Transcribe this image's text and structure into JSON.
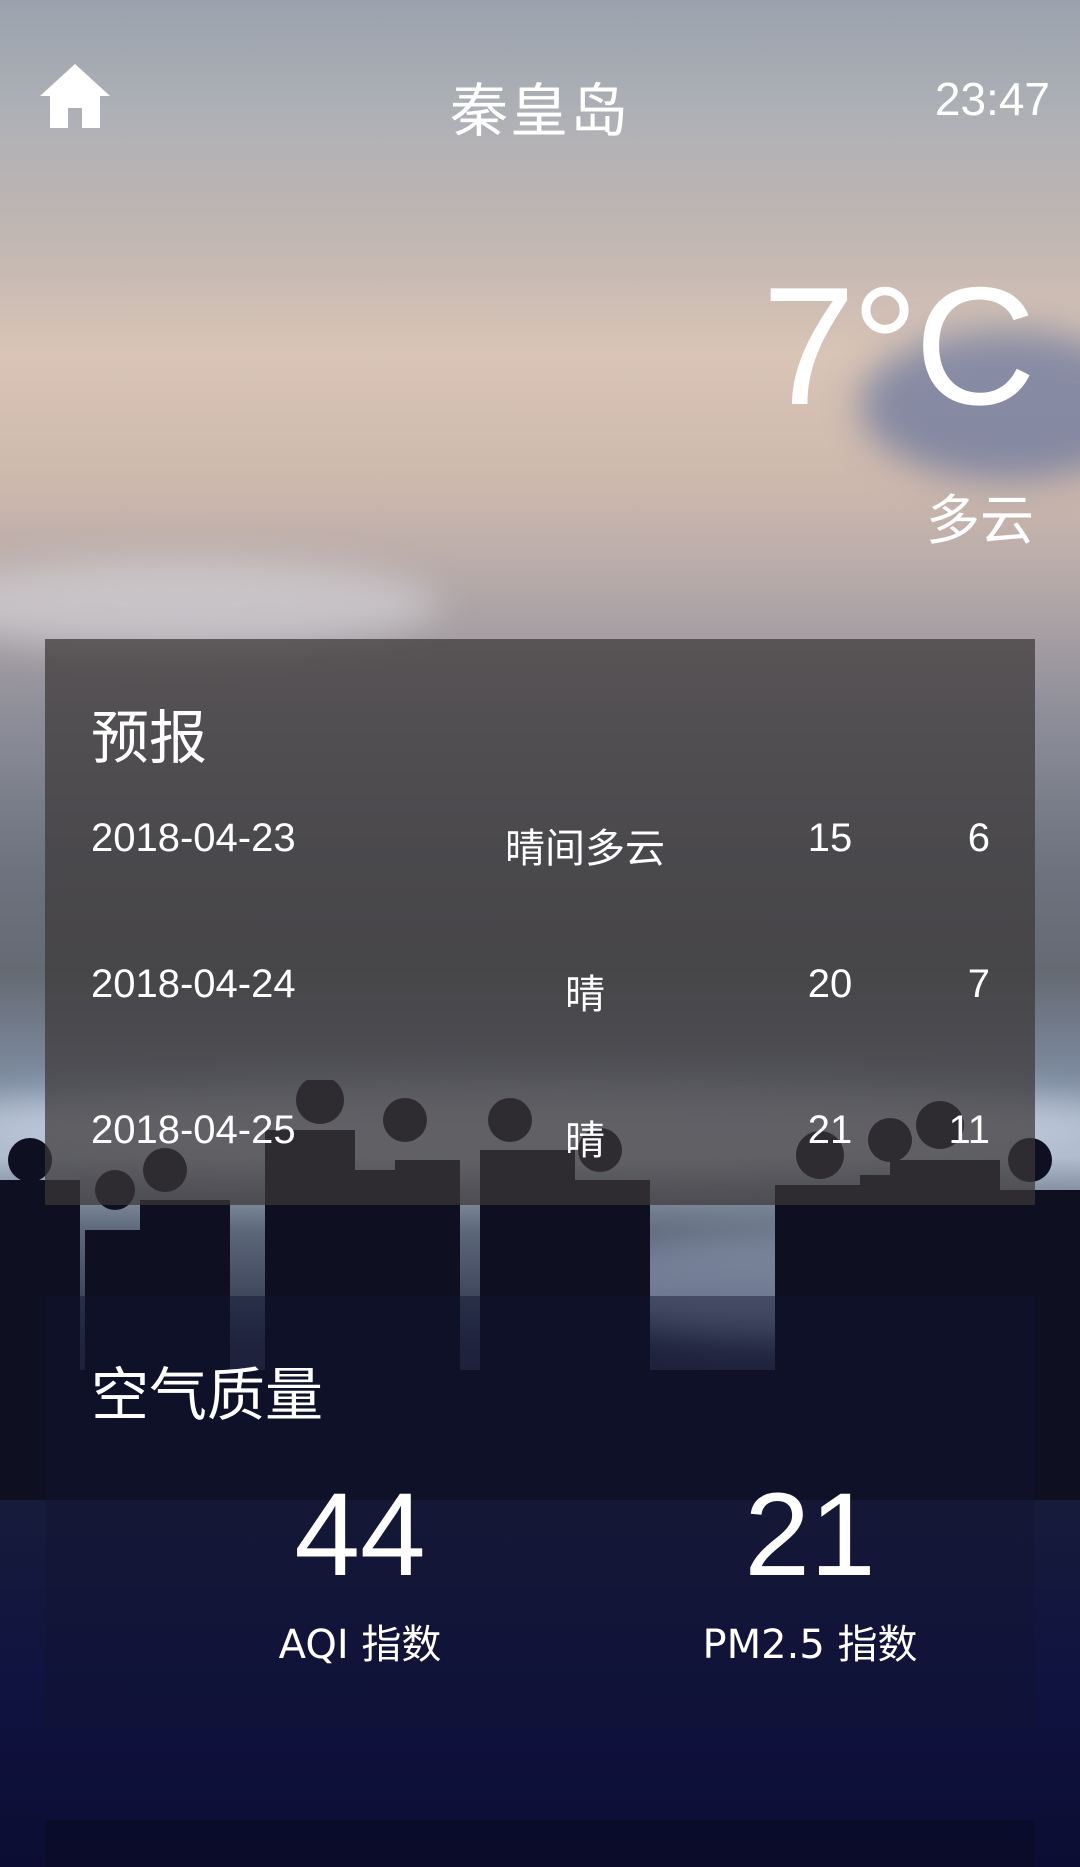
{
  "header": {
    "city": "秦皇岛",
    "time": "23:47"
  },
  "current": {
    "temperature": "7°C",
    "condition": "多云"
  },
  "forecast": {
    "title": "预报",
    "rows": [
      {
        "date": "2018-04-23",
        "condition": "晴间多云",
        "max": "15",
        "min": "6"
      },
      {
        "date": "2018-04-24",
        "condition": "晴",
        "max": "20",
        "min": "7"
      },
      {
        "date": "2018-04-25",
        "condition": "晴",
        "max": "21",
        "min": "11"
      }
    ]
  },
  "air_quality": {
    "title": "空气质量",
    "aqi_value": "44",
    "aqi_label": "AQI 指数",
    "pm25_value": "21",
    "pm25_label": "PM2.5 指数"
  },
  "icons": {
    "home": "home-icon"
  },
  "colors": {
    "text": "#ffffff",
    "forecast_panel": "#3c3838",
    "air_panel": "#121430"
  }
}
